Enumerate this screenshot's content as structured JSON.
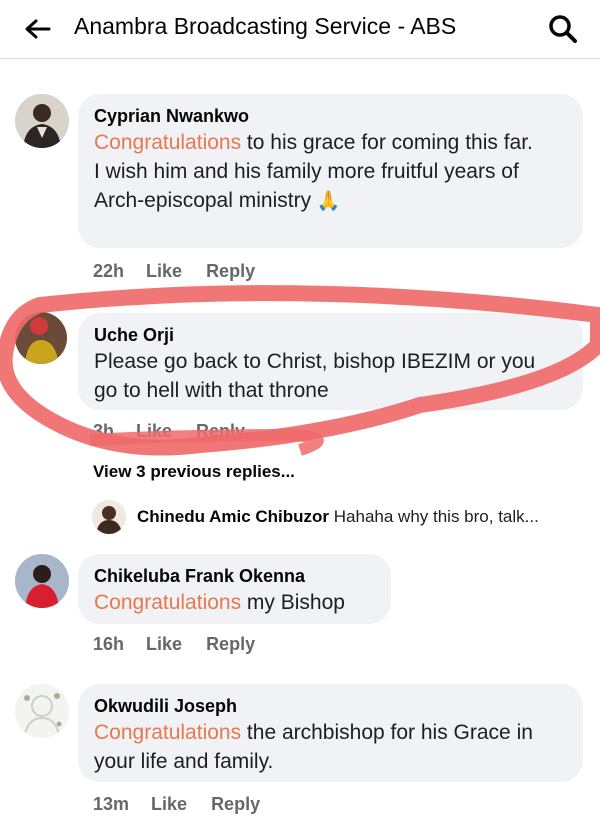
{
  "header": {
    "title": "Anambra Broadcasting Service - ABS",
    "back_icon": "arrow-left-icon",
    "search_icon": "search-icon"
  },
  "comments": [
    {
      "author": "Cyprian Nwankwo",
      "highlight": "Congratulations",
      "text_after_highlight": " to his grace for coming this far.",
      "text_line2": "I wish him and his family more fruitful years of Arch-episcopal ministry",
      "emoji": "🙏",
      "time": "22h",
      "like": "Like",
      "reply": "Reply"
    },
    {
      "author": "Uche Orji",
      "text": "Please go back to Christ,  bishop IBEZIM or you go to hell with that throne",
      "time": "3h",
      "like": "Like",
      "reply": "Reply",
      "view_replies": "View 3 previous replies...",
      "reply_preview_author": "Chinedu Amic Chibuzor",
      "reply_preview_text": "Hahaha why this bro, talk..."
    },
    {
      "author": "Chikeluba Frank Okenna",
      "highlight": "Congratulations",
      "text_after_highlight": " my Bishop",
      "time": "16h",
      "like": "Like",
      "reply": "Reply"
    },
    {
      "author": "Okwudili Joseph",
      "highlight": "Congratulations",
      "text_after_highlight": " the archbishop for his Grace in your life and family.",
      "time": "13m",
      "like": "Like",
      "reply": "Reply"
    }
  ],
  "colors": {
    "highlight": "#e8784d",
    "bubble": "#f0f2f5",
    "scribble": "#f06a6a",
    "meta": "#65676b"
  }
}
